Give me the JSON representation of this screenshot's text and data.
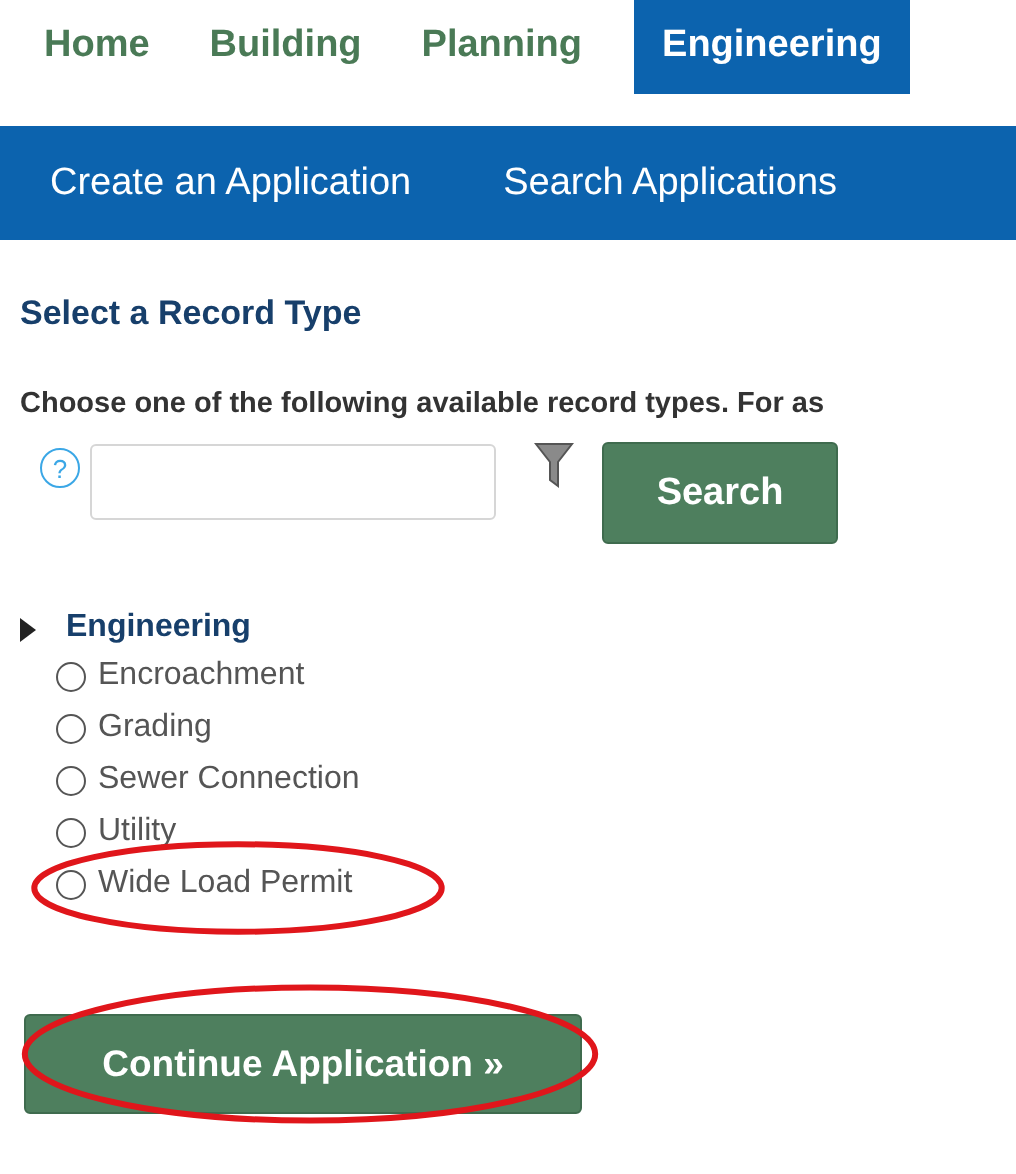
{
  "tabs": [
    {
      "label": "Home",
      "selected": false
    },
    {
      "label": "Building",
      "selected": false
    },
    {
      "label": "Planning",
      "selected": false
    },
    {
      "label": "Engineering",
      "selected": true
    }
  ],
  "subnav": [
    "Create an Application",
    "Search Applications"
  ],
  "heading": "Select a Record Type",
  "instructions": "Choose one of the following available record types. For as",
  "search": {
    "help": "?",
    "button": "Search"
  },
  "tree": {
    "label": "Engineering",
    "expanded": true,
    "children": [
      {
        "label": "Encroachment",
        "selected": false,
        "highlighted": false
      },
      {
        "label": "Grading",
        "selected": false,
        "highlighted": false
      },
      {
        "label": "Sewer Connection",
        "selected": false,
        "highlighted": false
      },
      {
        "label": "Utility",
        "selected": false,
        "highlighted": false
      },
      {
        "label": "Wide Load Permit",
        "selected": false,
        "highlighted": true
      }
    ]
  },
  "continue": {
    "label": "Continue Application »",
    "highlighted": true
  }
}
